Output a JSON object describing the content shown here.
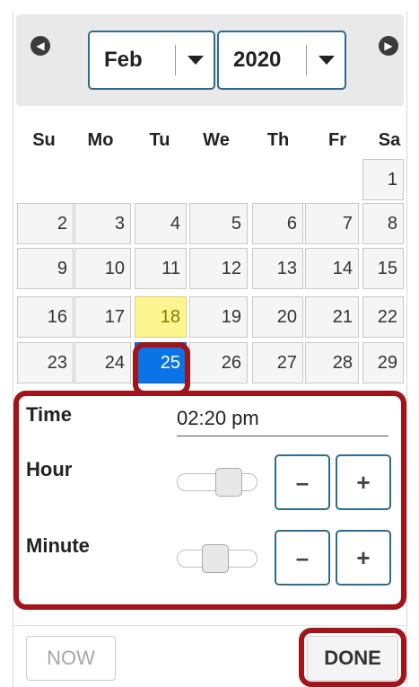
{
  "header": {
    "prev_icon": "chevron-left-icon",
    "next_icon": "chevron-right-icon",
    "month": "Feb",
    "year": "2020"
  },
  "weekdays": [
    "Su",
    "Mo",
    "Tu",
    "We",
    "Th",
    "Fr",
    "Sa"
  ],
  "days": [
    {
      "label": "1",
      "state": "normal"
    },
    {
      "label": "2",
      "state": "normal"
    },
    {
      "label": "3",
      "state": "normal"
    },
    {
      "label": "4",
      "state": "normal"
    },
    {
      "label": "5",
      "state": "normal"
    },
    {
      "label": "6",
      "state": "normal"
    },
    {
      "label": "7",
      "state": "normal"
    },
    {
      "label": "8",
      "state": "normal"
    },
    {
      "label": "9",
      "state": "normal"
    },
    {
      "label": "10",
      "state": "normal"
    },
    {
      "label": "11",
      "state": "normal"
    },
    {
      "label": "12",
      "state": "normal"
    },
    {
      "label": "13",
      "state": "normal"
    },
    {
      "label": "14",
      "state": "normal"
    },
    {
      "label": "15",
      "state": "normal"
    },
    {
      "label": "16",
      "state": "normal"
    },
    {
      "label": "17",
      "state": "normal"
    },
    {
      "label": "18",
      "state": "today"
    },
    {
      "label": "19",
      "state": "normal"
    },
    {
      "label": "20",
      "state": "normal"
    },
    {
      "label": "21",
      "state": "normal"
    },
    {
      "label": "22",
      "state": "normal"
    },
    {
      "label": "23",
      "state": "normal"
    },
    {
      "label": "24",
      "state": "normal"
    },
    {
      "label": "25",
      "state": "selected"
    },
    {
      "label": "26",
      "state": "normal"
    },
    {
      "label": "27",
      "state": "normal"
    },
    {
      "label": "28",
      "state": "normal"
    },
    {
      "label": "29",
      "state": "normal"
    }
  ],
  "time": {
    "time_label": "Time",
    "time_value": "02:20 pm",
    "hour_label": "Hour",
    "hour_level": 0.7,
    "minute_label": "Minute",
    "minute_level": 0.45,
    "minus": "–",
    "plus": "+"
  },
  "footer": {
    "now_label": "NOW",
    "done_label": "DONE"
  },
  "colors": {
    "highlight": "#a0141a",
    "selected_day": "#0a74e6",
    "today_day": "#fcf48f",
    "select_border": "#2f6b8e"
  }
}
